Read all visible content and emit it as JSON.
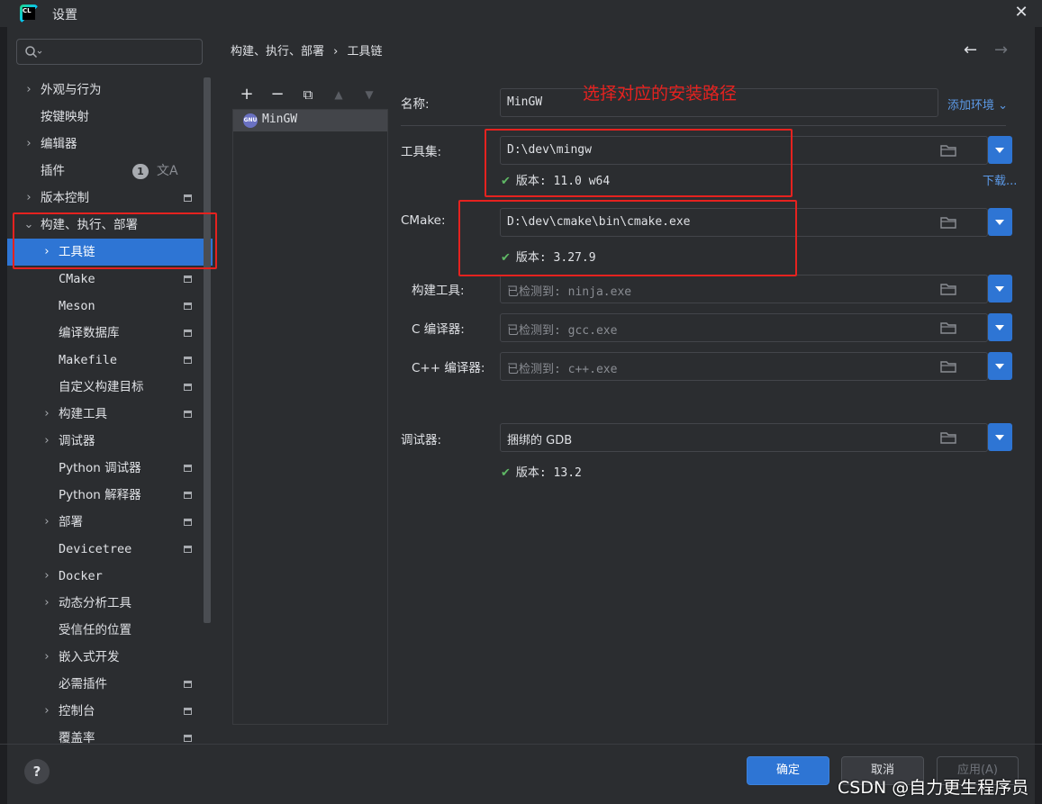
{
  "window": {
    "title": "设置"
  },
  "search": {
    "placeholder": ""
  },
  "breadcrumb": {
    "parent": "构建、执行、部署",
    "separator": "›",
    "current": "工具链"
  },
  "sidebar": {
    "items": [
      {
        "label": "外观与行为",
        "chevron": "›"
      },
      {
        "label": "按键映射"
      },
      {
        "label": "编辑器",
        "chevron": "›"
      },
      {
        "label": "插件",
        "badge": "1"
      },
      {
        "label": "版本控制",
        "chevron": "›"
      },
      {
        "label": "构建、执行、部署",
        "chevron": "⌄"
      },
      {
        "label": "工具链",
        "chevron": "›"
      },
      {
        "label": "CMake"
      },
      {
        "label": "Meson"
      },
      {
        "label": "编译数据库"
      },
      {
        "label": "Makefile"
      },
      {
        "label": "自定义构建目标"
      },
      {
        "label": "构建工具",
        "chevron": "›"
      },
      {
        "label": "调试器",
        "chevron": "›"
      },
      {
        "label": "Python 调试器"
      },
      {
        "label": "Python 解释器"
      },
      {
        "label": "部署",
        "chevron": "›"
      },
      {
        "label": "Devicetree"
      },
      {
        "label": "Docker",
        "chevron": "›"
      },
      {
        "label": "动态分析工具",
        "chevron": "›"
      },
      {
        "label": "受信任的位置"
      },
      {
        "label": "嵌入式开发",
        "chevron": "›"
      },
      {
        "label": "必需插件"
      },
      {
        "label": "控制台",
        "chevron": "›"
      },
      {
        "label": "覆盖率"
      }
    ]
  },
  "toolchains": {
    "toolbar": {
      "add": "+",
      "remove": "−",
      "copy": "⧉",
      "up": "▲",
      "down": "▼"
    },
    "items": [
      {
        "name": "MinGW",
        "icon": "gnu-icon",
        "icon_text": "GNU"
      }
    ]
  },
  "form": {
    "name_label": "名称:",
    "name_value": "MinGW",
    "add_env": "添加环境",
    "toolset_label": "工具集:",
    "toolset_value": "D:\\dev\\mingw",
    "toolset_version": "版本: 11.0 w64",
    "download": "下载...",
    "cmake_label": "CMake:",
    "cmake_value": "D:\\dev\\cmake\\bin\\cmake.exe",
    "cmake_version": "版本: 3.27.9",
    "build_tool_label": "构建工具:",
    "build_tool_value": "已检测到: ninja.exe",
    "c_compiler_label": "C 编译器:",
    "c_compiler_value": "已检测到: gcc.exe",
    "cpp_compiler_label": "C++ 编译器:",
    "cpp_compiler_value": "已检测到: c++.exe",
    "debugger_label": "调试器:",
    "debugger_value": "捆绑的 GDB",
    "debugger_version": "版本: 13.2"
  },
  "annotation": {
    "text": "选择对应的安装路径",
    "color": "#e5221f"
  },
  "footer": {
    "help": "?",
    "ok": "确定",
    "cancel": "取消",
    "apply": "应用(A)"
  },
  "watermark": "CSDN @自力更生程序员",
  "colors": {
    "accent": "#2e75d4",
    "success": "#5fb865",
    "link": "#5c9ae8"
  }
}
